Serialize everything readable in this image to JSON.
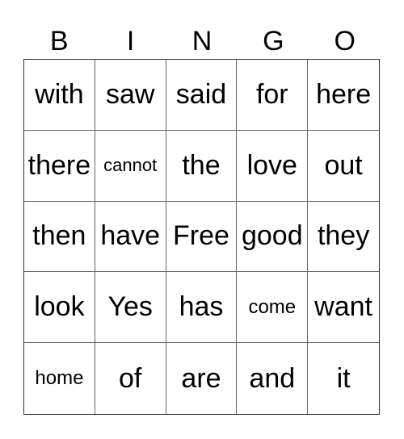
{
  "header": [
    "B",
    "I",
    "N",
    "G",
    "O"
  ],
  "rows": [
    [
      "with",
      "saw",
      "said",
      "for",
      "here"
    ],
    [
      "there",
      "cannot",
      "the",
      "love",
      "out"
    ],
    [
      "then",
      "have",
      "Free",
      "good",
      "they"
    ],
    [
      "look",
      "Yes",
      "has",
      "come",
      "want"
    ],
    [
      "home",
      "of",
      "are",
      "and",
      "it"
    ]
  ]
}
